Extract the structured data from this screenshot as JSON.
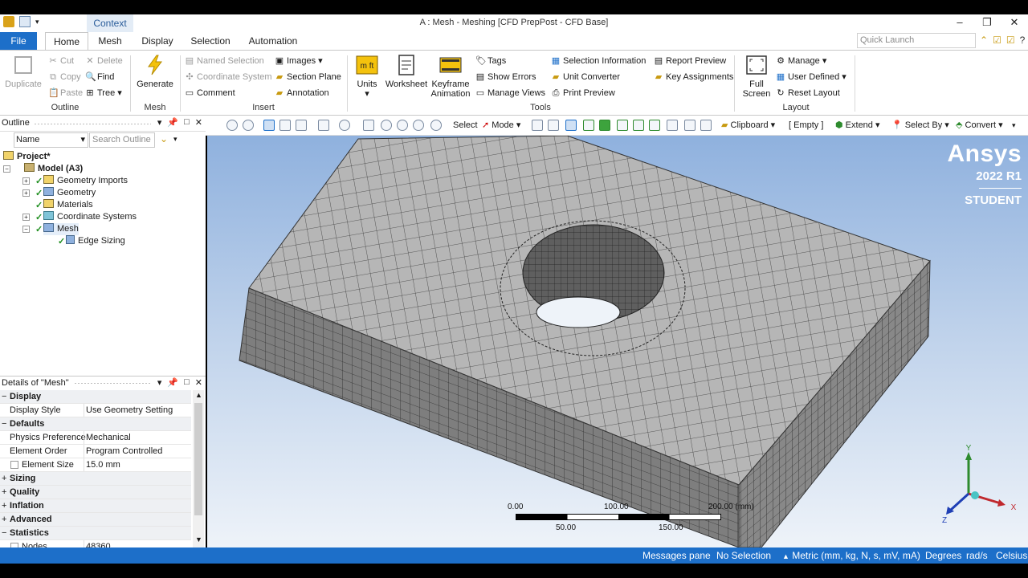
{
  "titlebar": {
    "context_tab": "Context",
    "title": "A : Mesh - Meshing [CFD PrepPost - CFD Base]"
  },
  "tabs": {
    "file": "File",
    "items": [
      "Home",
      "Mesh",
      "Display",
      "Selection",
      "Automation"
    ],
    "quick_launch_placeholder": "Quick Launch"
  },
  "ribbon": {
    "outline": {
      "label": "Outline",
      "duplicate": "Duplicate",
      "cut": "Cut",
      "copy": "Copy",
      "paste": "Paste",
      "delete": "Delete",
      "find": "Find",
      "tree": "Tree"
    },
    "mesh": {
      "label": "Mesh",
      "generate": "Generate"
    },
    "insert": {
      "label": "Insert",
      "named_selection": "Named Selection",
      "coordinate_system": "Coordinate System",
      "comment": "Comment",
      "images": "Images",
      "section_plane": "Section Plane",
      "annotation": "Annotation"
    },
    "tools": {
      "label": "Tools",
      "units": "Units",
      "worksheet": "Worksheet",
      "keyframe": "Keyframe",
      "animation": "Animation",
      "tags": "Tags",
      "show_errors": "Show Errors",
      "manage_views": "Manage Views",
      "selection_information": "Selection Information",
      "unit_converter": "Unit Converter",
      "print_preview": "Print Preview",
      "report_preview": "Report Preview",
      "key_assignments": "Key Assignments"
    },
    "layout": {
      "label": "Layout",
      "full": "Full",
      "screen": "Screen",
      "manage": "Manage",
      "user_defined": "User Defined",
      "reset_layout": "Reset Layout"
    }
  },
  "outline_pane": {
    "title": "Outline",
    "name_select": "Name",
    "search_placeholder": "Search Outline",
    "tree": {
      "project": "Project*",
      "model": "Model (A3)",
      "geometry_imports": "Geometry Imports",
      "geometry": "Geometry",
      "materials": "Materials",
      "coordinate_systems": "Coordinate Systems",
      "mesh": "Mesh",
      "edge_sizing": "Edge Sizing"
    }
  },
  "details_pane": {
    "title": "Details of \"Mesh\"",
    "rows": {
      "display": "Display",
      "display_style_k": "Display Style",
      "display_style_v": "Use Geometry Setting",
      "defaults": "Defaults",
      "physics_k": "Physics Preference",
      "physics_v": "Mechanical",
      "order_k": "Element Order",
      "order_v": "Program Controlled",
      "size_k": "Element Size",
      "size_v": "15.0 mm",
      "sizing": "Sizing",
      "quality": "Quality",
      "inflation": "Inflation",
      "advanced": "Advanced",
      "statistics": "Statistics",
      "nodes_k": "Nodes",
      "nodes_v": "48360"
    }
  },
  "graphics_toolbar": {
    "select": "Select",
    "mode": "Mode",
    "clipboard": "Clipboard",
    "empty": "[ Empty ]",
    "extend": "Extend",
    "select_by": "Select By",
    "convert": "Convert"
  },
  "viewport": {
    "logo": "Ansys",
    "version": "2022 R1",
    "edition": "STUDENT",
    "scale_labels": {
      "s0": "0.00",
      "s100": "100.00",
      "s200": "200.00 (mm)",
      "s50": "50.00",
      "s150": "150.00"
    },
    "axes": {
      "x": "X",
      "y": "Y",
      "z": "Z"
    }
  },
  "statusbar": {
    "messages": "Messages pane",
    "selection": "No Selection",
    "units": "Metric (mm, kg, N, s, mV, mA)",
    "angle": "Degrees",
    "rate": "rad/s",
    "temp": "Celsius"
  },
  "colors": {
    "accent": "#1d6fc9",
    "mesh_face": "#b4b4b4",
    "mesh_side": "#7a7a7a"
  }
}
